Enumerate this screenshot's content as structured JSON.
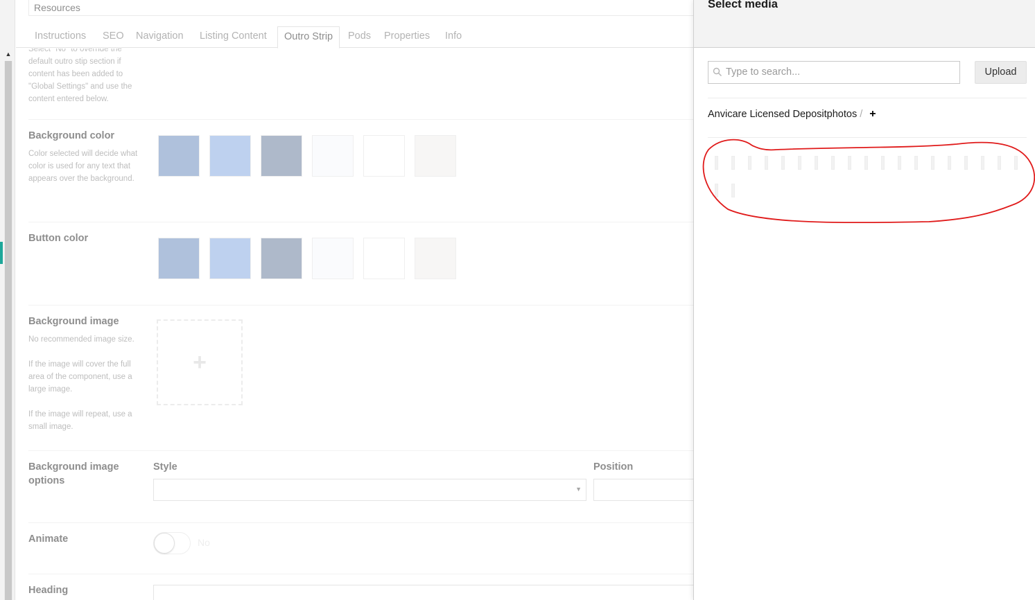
{
  "editor": {
    "name_field_value": "Resources",
    "tabs": [
      {
        "label": "Instructions"
      },
      {
        "label": "SEO"
      },
      {
        "label": "Navigation"
      },
      {
        "label": "Listing Content"
      },
      {
        "label": "Outro Strip",
        "active": true
      },
      {
        "label": "Pods"
      },
      {
        "label": "Properties"
      },
      {
        "label": "Info"
      }
    ],
    "top_description": "Select \"No\" to override the default outro stip section if content has been added to \"Global Settings\" and use the content entered below.",
    "background_color": {
      "label": "Background color",
      "description": "Color selected will decide what color is used for any text that appears over the background.",
      "swatches": [
        "#84a0c9",
        "#9cb9e6",
        "#8394ae",
        "#f7f9fc",
        "#ffffff",
        "#f3f2f0"
      ]
    },
    "button_color": {
      "label": "Button color",
      "swatches": [
        "#84a0c9",
        "#9cb9e6",
        "#8394ae",
        "#f7f9fc",
        "#ffffff",
        "#f3f2f0"
      ]
    },
    "background_image": {
      "label": "Background image",
      "desc_1": "No recommended image size.",
      "desc_2": "If the image will cover the full area of the component, use a large image.",
      "desc_3": "If the image will repeat, use a small image.",
      "add_icon": "plus-icon"
    },
    "background_image_options": {
      "label": "Background image options",
      "style_label": "Style",
      "style_value": "",
      "position_label": "Position",
      "position_value": ""
    },
    "animate": {
      "label": "Animate",
      "toggle_text": "No",
      "enabled": false
    },
    "heading": {
      "label": "Heading",
      "value": ""
    }
  },
  "media_panel": {
    "title": "Select media",
    "search_placeholder": "Type to search...",
    "upload_label": "Upload",
    "breadcrumb": {
      "folder": "Anvicare Licensed Depositphotos",
      "separator": "/",
      "add": "+"
    },
    "annotation_color": "#e01a1a"
  }
}
